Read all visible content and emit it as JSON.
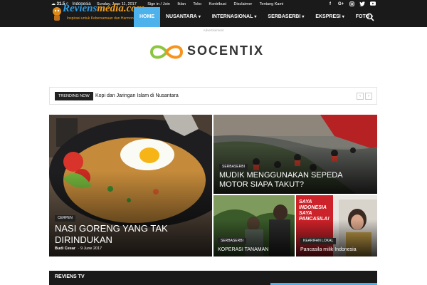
{
  "weather": {
    "temp": "31.5",
    "unit": "C",
    "city": "Indonesia"
  },
  "topbar": {
    "date": "Sunday, June 11, 2017",
    "links": [
      "Sign in / Join",
      "Iklan",
      "Toko",
      "Kontribusi",
      "Disclaimer",
      "Tentang Kami"
    ]
  },
  "socials": [
    "f",
    "G+",
    "ig",
    "tw",
    "yt"
  ],
  "brand": {
    "name_a": "Reviens",
    "name_b": "media.com",
    "tagline": "Inspirasi untuk Kebersamaan dan Harmoni"
  },
  "nav": {
    "items": [
      {
        "label": "HOME",
        "active": true,
        "has_caret": false
      },
      {
        "label": "NUSANTARA",
        "active": false,
        "has_caret": true
      },
      {
        "label": "INTERNASIONAL",
        "active": false,
        "has_caret": true
      },
      {
        "label": "SERBASERBI",
        "active": false,
        "has_caret": true
      },
      {
        "label": "EKSPRESI",
        "active": false,
        "has_caret": true
      },
      {
        "label": "FOTO",
        "active": false,
        "has_caret": true
      }
    ],
    "accent": "#4db2ec"
  },
  "ad": {
    "label": "Advertisement",
    "brand": "SOCENTIX"
  },
  "trending": {
    "label": "TRENDING NOW",
    "headline": "Kopi dan Jaringan Islam di Nusantara"
  },
  "featured": [
    {
      "category": "CERPEN",
      "title_line1": "NASI GORENG YANG TAK",
      "title_line2": "DIRINDUKAN",
      "author": "Budi Cesar",
      "date": "9 June 2017"
    },
    {
      "category": "SERBASERBI",
      "title_line1": "MUDIK MENGGUNAKAN SEPEDA",
      "title_line2": "MOTOR SIAPA TAKUT?"
    },
    {
      "category": "SERBASERBI",
      "title_line1": "KOPERASI TANAMAN"
    },
    {
      "category": "KEARIFAN LOKAL",
      "title_line1": "Pancasila milik Indonesia",
      "poster_text": "SAYA INDONESIA SAYA PANCASILA!"
    }
  ],
  "section": {
    "title": "REVIENS TV"
  }
}
